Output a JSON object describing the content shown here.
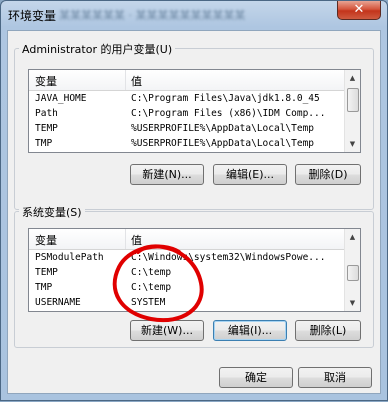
{
  "window": {
    "title": "环境变量",
    "title_blurred_text": "某某某某某某 · 某某某某某某某某某某",
    "close_icon": "close-icon"
  },
  "user_vars": {
    "group_label": "Administrator 的用户变量(U)",
    "columns": [
      "变量",
      "值"
    ],
    "rows": [
      {
        "name": "JAVA_HOME",
        "value": "C:\\Program Files\\Java\\jdk1.8.0_45"
      },
      {
        "name": "Path",
        "value": "C:\\Program Files (x86)\\IDM Comp..."
      },
      {
        "name": "TEMP",
        "value": "%USERPROFILE%\\AppData\\Local\\Temp"
      },
      {
        "name": "TMP",
        "value": "%USERPROFILE%\\AppData\\Local\\Temp"
      }
    ],
    "buttons": {
      "new": "新建(N)...",
      "edit": "编辑(E)...",
      "delete": "删除(D)"
    }
  },
  "system_vars": {
    "group_label": "系统变量(S)",
    "columns": [
      "变量",
      "值"
    ],
    "rows": [
      {
        "name": "PSModulePath",
        "value": "C:\\Windows\\system32\\WindowsPowe..."
      },
      {
        "name": "TEMP",
        "value": "C:\\temp"
      },
      {
        "name": "TMP",
        "value": "C:\\temp"
      },
      {
        "name": "USERNAME",
        "value": "SYSTEM"
      }
    ],
    "buttons": {
      "new": "新建(W)...",
      "edit": "编辑(I)...",
      "delete": "删除(L)"
    }
  },
  "footer": {
    "ok": "确定",
    "cancel": "取消"
  },
  "annotation": {
    "color": "#e00000"
  }
}
